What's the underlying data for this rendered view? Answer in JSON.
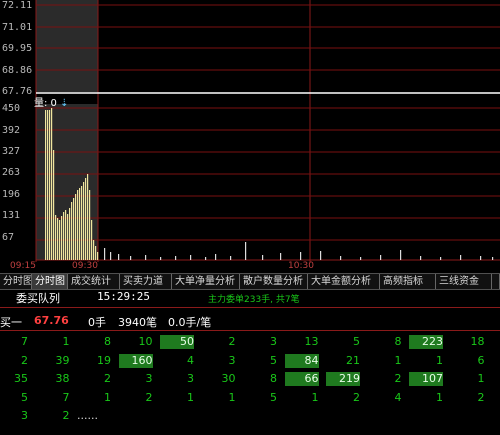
{
  "price_axis": [
    "72.11",
    "71.01",
    "69.95",
    "68.86",
    "67.76"
  ],
  "volume_label": "量: 0",
  "volume_axis": [
    "450",
    "392",
    "327",
    "263",
    "196",
    "131",
    "67"
  ],
  "time_axis": [
    "09:15",
    "09:30",
    "10:30"
  ],
  "tabs": [
    "分时图",
    "分时图",
    "成交统计",
    "买卖力道",
    "大单净量分析",
    "散户数量分析",
    "大单金额分析",
    "高频指标",
    "三线资金"
  ],
  "queue_title": "委买队列",
  "queue_time": "15:29:25",
  "queue_summary": "主力委单233手, 共7笔",
  "bid_label": "买一",
  "bid_price": "67.76",
  "bid_hands": "0手",
  "bid_orders": "3940笔",
  "bid_avg": "0.0手/笔",
  "order_rows": [
    [
      "7",
      "1",
      "8",
      "10",
      "50",
      "2",
      "3",
      "13",
      "5",
      "8",
      "223",
      "18"
    ],
    [
      "2",
      "39",
      "19",
      "160",
      "4",
      "3",
      "5",
      "84",
      "21",
      "1",
      "1",
      "6"
    ],
    [
      "35",
      "38",
      "2",
      "3",
      "3",
      "30",
      "8",
      "66",
      "219",
      "2",
      "107",
      "1"
    ],
    [
      "5",
      "7",
      "1",
      "2",
      "1",
      "1",
      "5",
      "1",
      "2",
      "4",
      "1",
      "2"
    ],
    [
      "3",
      "2",
      "......"
    ]
  ],
  "highlighted": [
    [
      "0",
      "4"
    ],
    [
      "0",
      "10"
    ],
    [
      "1",
      "3"
    ],
    [
      "1",
      "7"
    ],
    [
      "2",
      "7"
    ],
    [
      "2",
      "8"
    ],
    [
      "2",
      "10"
    ]
  ],
  "colors": {
    "grid_red": "#7a1010",
    "volume_yellow": "#f0e6a0",
    "queue_green": "#19c819",
    "bid_red": "#ff4040"
  }
}
